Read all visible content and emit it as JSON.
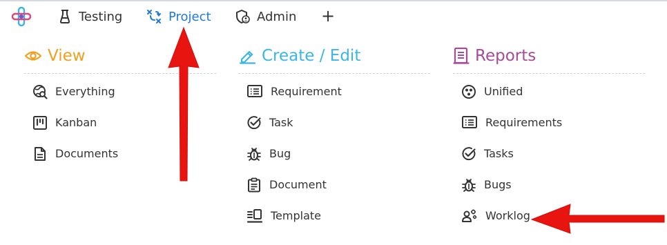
{
  "nav": {
    "items": [
      {
        "label": "Testing",
        "icon": "flask-icon"
      },
      {
        "label": "Project",
        "icon": "project-flow-icon",
        "active": true
      },
      {
        "label": "Admin",
        "icon": "shield-user-icon"
      }
    ],
    "add_icon": "plus-icon",
    "add_label": "+"
  },
  "colors": {
    "view": "#f0a020",
    "create": "#3bb6e4",
    "reports": "#a74a97",
    "active_nav": "#1f7ad6",
    "arrow": "#e8140f"
  },
  "columns": [
    {
      "title": "View",
      "icon": "eye-icon",
      "items": [
        {
          "label": "Everything",
          "icon": "globe-search-icon"
        },
        {
          "label": "Kanban",
          "icon": "kanban-board-icon"
        },
        {
          "label": "Documents",
          "icon": "document-icon"
        }
      ]
    },
    {
      "title": "Create / Edit",
      "icon": "pen-icon",
      "items": [
        {
          "label": "Requirement",
          "icon": "list-box-icon"
        },
        {
          "label": "Task",
          "icon": "check-circle-icon"
        },
        {
          "label": "Bug",
          "icon": "bug-icon"
        },
        {
          "label": "Document",
          "icon": "clipboard-icon"
        },
        {
          "label": "Template",
          "icon": "template-icon"
        }
      ]
    },
    {
      "title": "Reports",
      "icon": "report-icon",
      "items": [
        {
          "label": "Unified",
          "icon": "dots-circle-icon"
        },
        {
          "label": "Requirements",
          "icon": "list-box-icon"
        },
        {
          "label": "Tasks",
          "icon": "check-circle-icon"
        },
        {
          "label": "Bugs",
          "icon": "bug-icon"
        },
        {
          "label": "Worklog",
          "icon": "user-gears-icon"
        }
      ]
    }
  ]
}
